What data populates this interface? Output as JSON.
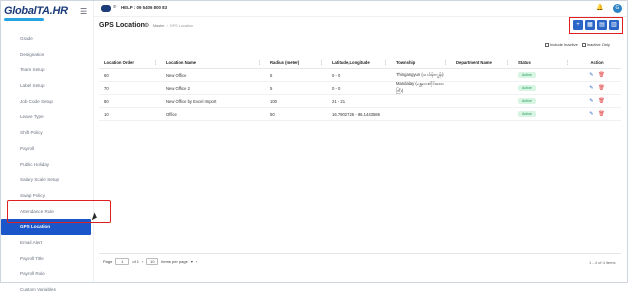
{
  "brand": {
    "logo_main": "Global",
    "logo_ta": "TA.HR"
  },
  "header": {
    "help_label": "HELP : 09 5406 800 83",
    "phone_icon": "phone-icon",
    "bell_icon": "bell-icon",
    "avatar_initial": "G"
  },
  "sidebar": {
    "items": [
      {
        "label": "Grade"
      },
      {
        "label": "Designation"
      },
      {
        "label": "Team Setup"
      },
      {
        "label": "Label Setup"
      },
      {
        "label": "Job Code Setup"
      },
      {
        "label": "Leave Type"
      },
      {
        "label": "Shift Policy"
      },
      {
        "label": "Payroll"
      },
      {
        "label": "Public Holiday"
      },
      {
        "label": "Salary Scale Setup"
      },
      {
        "label": "Swap Policy"
      },
      {
        "label": "Attendance Rule"
      },
      {
        "label": "GPS Location"
      },
      {
        "label": "Email Alert"
      },
      {
        "label": "Payroll Title"
      },
      {
        "label": "Payroll Rule"
      },
      {
        "label": "Custom Variables"
      }
    ],
    "active_index": 12
  },
  "page": {
    "title": "GPS Location",
    "breadcrumb": {
      "b1": "Master",
      "b2": "GPS Location"
    }
  },
  "toolbar": {
    "add_icon": "plus-icon",
    "btn2_icon": "grid-icon",
    "btn3_icon": "import-icon",
    "btn4_icon": "export-icon"
  },
  "filters": {
    "include_inactive": "Include Inactive",
    "inactive_only": "Inactive Only"
  },
  "table": {
    "headers": [
      "Location Order",
      "Location Name",
      "Radius (meter)",
      "Latitude,Longitude",
      "Township",
      "Department Name",
      "Status",
      "Action"
    ],
    "rows": [
      {
        "order": "60",
        "name": "New Office",
        "radius": "5",
        "latlng": "0 - 0",
        "township": "Thingangyun (သင်္ဃန်းကျွန်း)",
        "dept": "",
        "status": "Active"
      },
      {
        "order": "70",
        "name": "New Office 2",
        "radius": "5",
        "latlng": "0 - 0",
        "township": "Mandalay (မန္တလေးတိုင်းဒေသကြီး)",
        "dept": "",
        "status": "Active"
      },
      {
        "order": "80",
        "name": "New Office by Excel Import",
        "radius": "100",
        "latlng": "21 - 21",
        "township": "",
        "dept": "",
        "status": "Active"
      },
      {
        "order": "10",
        "name": "Office",
        "radius": "50",
        "latlng": "16.7902725 - 96.1443586",
        "township": "",
        "dept": "",
        "status": "Active"
      }
    ]
  },
  "pagination": {
    "page_label": "Page",
    "page_value": "1",
    "of_label": "of 1",
    "per_page_value": "10",
    "per_page_label": "items per page",
    "range_text": "1 - 4 of 4 items"
  }
}
